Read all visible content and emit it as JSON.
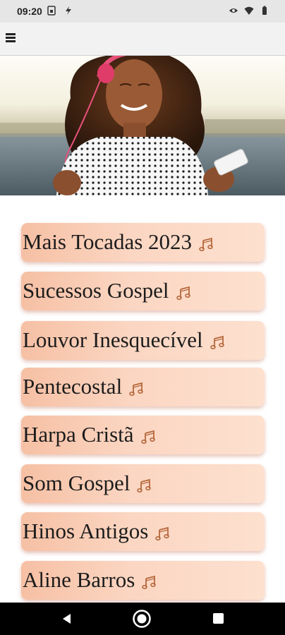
{
  "status_bar": {
    "time": "09:20",
    "left_icons": [
      "sim-card-icon",
      "flash-icon"
    ],
    "right_icons": [
      "eye-icon",
      "wifi-icon",
      "battery-icon"
    ]
  },
  "app_bar": {
    "menu_icon": "hamburger-menu-icon"
  },
  "hero": {
    "image": "woman-with-headphones-photo"
  },
  "playlists": [
    {
      "label": "Mais Tocadas 2023",
      "icon": "music-note-icon"
    },
    {
      "label": "Sucessos Gospel",
      "icon": "music-note-icon"
    },
    {
      "label": "Louvor Inesquecível",
      "icon": "music-note-icon"
    },
    {
      "label": "Pentecostal",
      "icon": "music-note-icon"
    },
    {
      "label": "Harpa Cristã",
      "icon": "music-note-icon"
    },
    {
      "label": "Som Gospel",
      "icon": "music-note-icon"
    },
    {
      "label": "Hinos Antigos",
      "icon": "music-note-icon"
    },
    {
      "label": "Aline Barros",
      "icon": "music-note-icon"
    }
  ],
  "nav_bar": {
    "icons": [
      "back-icon",
      "home-icon",
      "recents-icon"
    ]
  },
  "colors": {
    "button_gradient_start": "#f6c0a4",
    "button_gradient_end": "#fde0cf",
    "note_color": "#b5683c"
  }
}
